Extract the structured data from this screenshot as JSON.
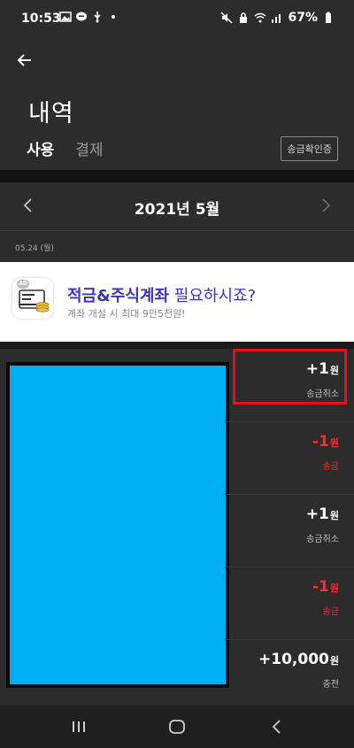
{
  "status_bar": {
    "time": "10:53",
    "battery": "67%"
  },
  "header": {
    "title": "내역",
    "tabs": [
      {
        "label": "사용",
        "active": true
      },
      {
        "label": "결제",
        "active": false
      }
    ],
    "verify_button": "송금확인증"
  },
  "month_nav": {
    "month": "2021년 5월"
  },
  "date_group": {
    "date": "05.24 (월)"
  },
  "ad": {
    "badge": "AD",
    "title_bold": "적금&주식계좌",
    "title_rest": " 필요하시죠?",
    "subtitle": "계좌 개설 시 최대 9만5천원!",
    "title_color": "#3b35b8"
  },
  "transactions": [
    {
      "amount": "+1",
      "unit": "원",
      "type": "송금취소",
      "sign": "plus"
    },
    {
      "amount": "-1",
      "unit": "원",
      "type": "송금",
      "sign": "minus"
    },
    {
      "amount": "+1",
      "unit": "원",
      "type": "송금취소",
      "sign": "plus"
    },
    {
      "amount": "-1",
      "unit": "원",
      "type": "송금",
      "sign": "minus"
    },
    {
      "amount": "+10,000",
      "unit": "원",
      "type": "충전",
      "sign": "plus"
    }
  ],
  "colors": {
    "accent": "#ffd400",
    "negative": "#ff2a2a",
    "highlight": "#e6101a",
    "redaction": "#02aef3"
  }
}
